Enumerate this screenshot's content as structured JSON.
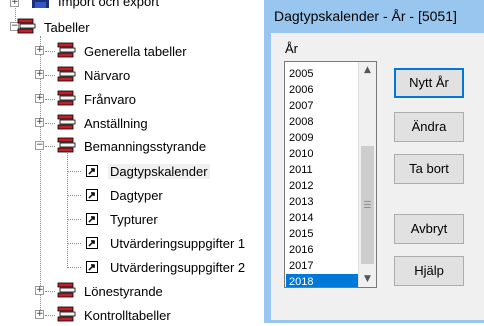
{
  "tree": {
    "items": [
      {
        "label": "Import och export",
        "icon": "floppy-disk-icon"
      },
      {
        "label": "Tabeller",
        "icon": "book-stack-icon"
      },
      {
        "label": "Generella tabeller",
        "icon": "book-stack-icon"
      },
      {
        "label": "Närvaro",
        "icon": "book-stack-icon"
      },
      {
        "label": "Frånvaro",
        "icon": "book-stack-icon"
      },
      {
        "label": "Anställning",
        "icon": "book-stack-icon"
      },
      {
        "label": "Bemanningsstyrande",
        "icon": "book-stack-icon"
      },
      {
        "label": "Dagtypskalender",
        "icon": "shortcut-icon",
        "selected": true
      },
      {
        "label": "Dagtyper",
        "icon": "shortcut-icon"
      },
      {
        "label": "Typturer",
        "icon": "shortcut-icon"
      },
      {
        "label": "Utvärderingsuppgifter 1",
        "icon": "shortcut-icon"
      },
      {
        "label": "Utvärderingsuppgifter 2",
        "icon": "shortcut-icon"
      },
      {
        "label": "Lönestyrande",
        "icon": "book-stack-icon"
      },
      {
        "label": "Kontrolltabeller",
        "icon": "book-stack-icon"
      }
    ],
    "expand_symbols": {
      "collapsed": "+",
      "expanded": "−"
    }
  },
  "dialog": {
    "title": "Dagtypskalender - År - [5051]",
    "year_label": "År",
    "years": [
      "2005",
      "2006",
      "2007",
      "2008",
      "2009",
      "2010",
      "2011",
      "2012",
      "2013",
      "2014",
      "2015",
      "2016",
      "2017",
      "2018"
    ],
    "selected_year": "2018",
    "buttons": {
      "new": "Nytt År",
      "edit": "Ändra",
      "delete": "Ta bort",
      "cancel": "Avbryt",
      "help": "Hjälp"
    },
    "colors": {
      "frame": "#99c6ef",
      "selection": "#0078d7",
      "default_border": "#0078d7"
    }
  }
}
